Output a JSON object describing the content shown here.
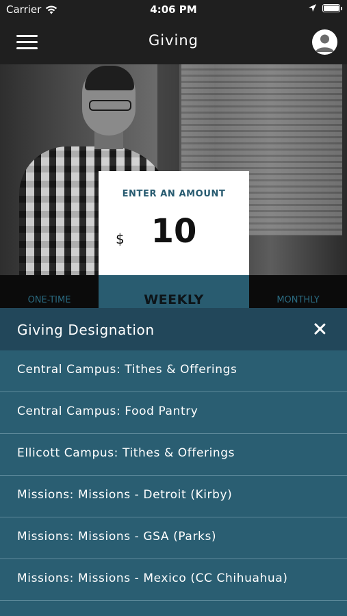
{
  "status_bar": {
    "carrier": "Carrier",
    "time": "4:06 PM",
    "wifi_icon": "wifi-icon",
    "location_icon": "location-arrow-icon",
    "battery_icon": "battery-icon"
  },
  "nav": {
    "title": "Giving",
    "menu_icon": "hamburger-menu-icon",
    "profile_icon": "user-avatar-icon"
  },
  "amount_card": {
    "label": "ENTER AN AMOUNT",
    "currency": "$",
    "amount": "10"
  },
  "frequency": {
    "options": [
      "ONE-TIME",
      "WEEKLY",
      "MONTHLY"
    ],
    "selected": "WEEKLY"
  },
  "designation": {
    "title": "Giving Designation",
    "close_icon": "close-icon",
    "items": [
      "Central Campus: Tithes & Offerings",
      "Central Campus: Food Pantry",
      "Ellicott Campus: Tithes & Offerings",
      "Missions: Missions - Detroit (Kirby)",
      "Missions: Missions - GSA (Parks)",
      "Missions: Missions - Mexico (CC Chihuahua)"
    ]
  },
  "colors": {
    "header_bg": "#1f1f1f",
    "accent_teal": "#285b70",
    "sheet_bg": "#2a5e72",
    "sheet_header_bg": "#22475a"
  }
}
